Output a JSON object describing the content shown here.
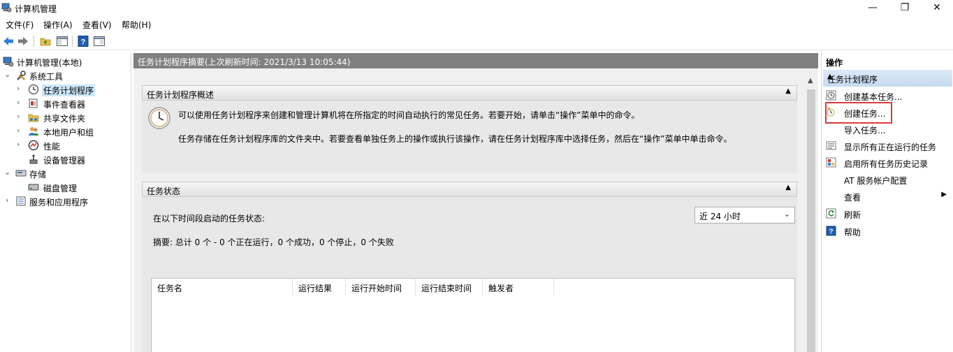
{
  "window": {
    "title": "计算机管理",
    "minimize": "—",
    "restore": "❐",
    "close": "✕"
  },
  "menu": [
    "文件(F)",
    "操作(A)",
    "查看(V)",
    "帮助(H)"
  ],
  "tree": {
    "root": "计算机管理(本地)",
    "system_tools": "系统工具",
    "task_scheduler": "任务计划程序",
    "event_viewer": "事件查看器",
    "shared_folders": "共享文件夹",
    "local_users": "本地用户和组",
    "performance": "性能",
    "device_manager": "设备管理器",
    "storage": "存储",
    "disk_management": "磁盘管理",
    "services_apps": "服务和应用程序"
  },
  "center": {
    "header": "任务计划程序摘要(上次刷新时间: 2021/3/13 10:05:44)",
    "overview_title": "任务计划程序概述",
    "overview_text1": "可以使用任务计划程序来创建和管理计算机将在所指定的时间自动执行的常见任务。若要开始，请单击“操作”菜单中的命令。",
    "overview_text2": "任务存储在任务计划程序库的文件夹中。若要查看单独任务上的操作或执行该操作，请在任务计划程序库中选择任务，然后在“操作”菜单中单击命令。",
    "status_title": "任务状态",
    "status_label": "在以下时间段启动的任务状态:",
    "period_value": "近 24 小时",
    "summary": "摘要: 总计 0 个 - 0 个正在运行，0 个成功，0 个停止，0 个失败",
    "columns": [
      "任务名",
      "运行结果",
      "运行开始时间",
      "运行结束时间",
      "触发者"
    ]
  },
  "actions": {
    "title": "操作",
    "section": "任务计划程序",
    "items": [
      "创建基本任务...",
      "创建任务...",
      "导入任务...",
      "显示所有正在运行的任务",
      "启用所有任务历史记录",
      "AT 服务帐户配置",
      "查看",
      "刷新",
      "帮助"
    ]
  },
  "colors": {
    "header_gray": "#808080",
    "actions_section": "#c7daf0",
    "highlight": "#d93b3b"
  }
}
